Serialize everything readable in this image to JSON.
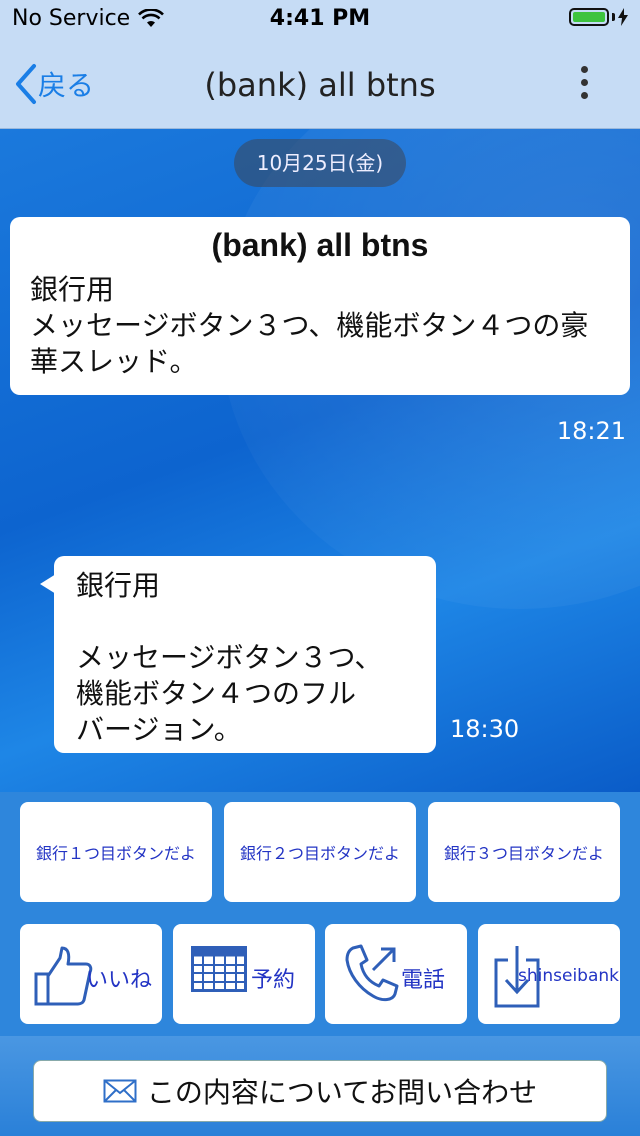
{
  "status_bar": {
    "carrier": "No Service",
    "time": "4:41 PM",
    "battery_level": 1.0
  },
  "nav": {
    "back_label": "戻る",
    "title": "(bank) all btns"
  },
  "chat": {
    "date": "10月25日(金)",
    "card": {
      "title": "(bank) all btns",
      "body": "銀行用\nメッセージボタン３つ、機能ボタン４つの豪華スレッド。",
      "time": "18:21"
    },
    "bubble": {
      "text": "銀行用\n\nメッセージボタン３つ、\n機能ボタン４つのフル\nバージョン。",
      "time": "18:30"
    }
  },
  "message_buttons": [
    "銀行１つ目ボタンだよ",
    "銀行２つ目ボタンだよ",
    "銀行３つ目ボタンだよ"
  ],
  "function_buttons": [
    {
      "label": "いいね",
      "icon": "thumbs-up-icon"
    },
    {
      "label": "予約",
      "icon": "calendar-grid-icon"
    },
    {
      "label": "電話",
      "icon": "phone-icon"
    },
    {
      "label": "shinseibank",
      "icon": "download-icon"
    }
  ],
  "footer": {
    "inquiry_label": "この内容についてお問い合わせ",
    "icon": "envelope-icon"
  },
  "colors": {
    "accent": "#1a7ee6",
    "button_text": "#2334c4",
    "nav_bg": "#c6dcf5",
    "chat_bg": "#0a6fd6"
  }
}
